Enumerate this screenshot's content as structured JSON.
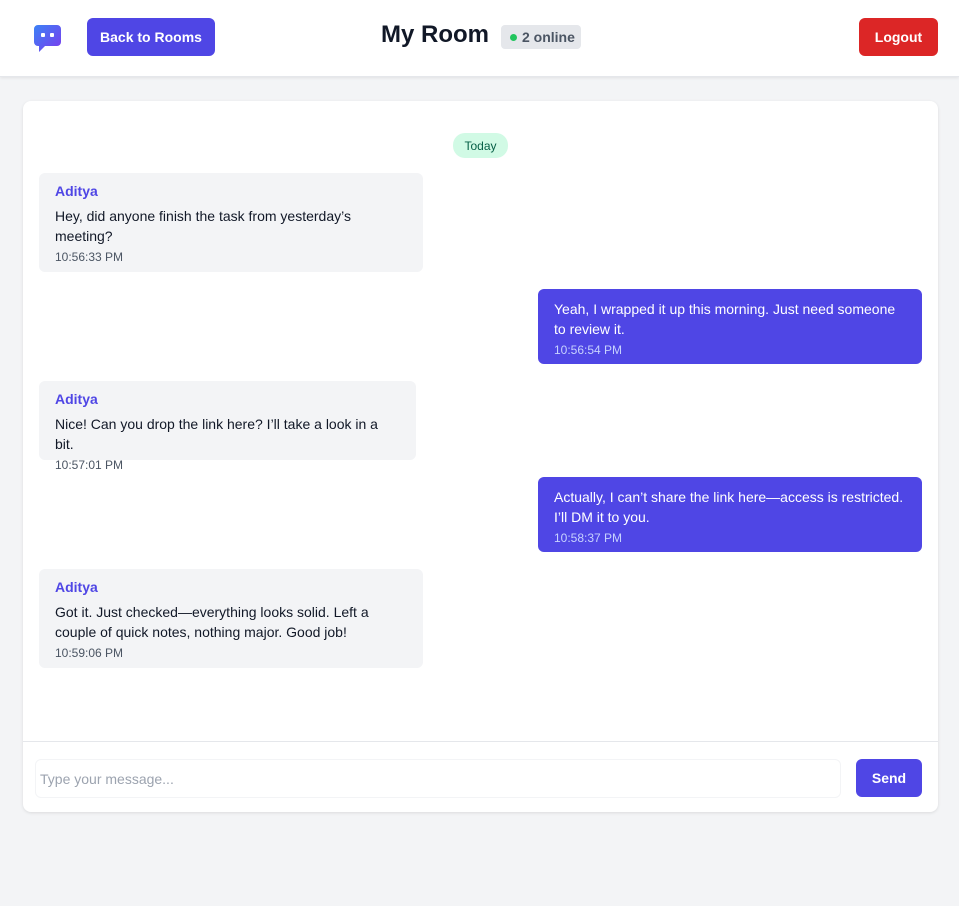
{
  "header": {
    "back_label": "Back to Rooms",
    "room_title": "My Room",
    "online_text": "2 online",
    "logout_label": "Logout"
  },
  "chat": {
    "date_label": "Today",
    "messages": [
      {
        "sender": "Aditya",
        "text": "Hey, did anyone finish the task from yesterday’s meeting?",
        "time": "10:56:33 PM",
        "mine": false
      },
      {
        "sender": "",
        "text": "Yeah, I wrapped it up this morning. Just need someone to review it.",
        "time": "10:56:54 PM",
        "mine": true
      },
      {
        "sender": "Aditya",
        "text": "Nice! Can you drop the link here? I’ll take a look in a bit.",
        "time": "10:57:01 PM",
        "mine": false
      },
      {
        "sender": "",
        "text": "Actually, I can’t share the link here—access is restricted. I’ll DM it to you.",
        "time": "10:58:37 PM",
        "mine": true
      },
      {
        "sender": "Aditya",
        "text": "Got it. Just checked—everything looks solid. Left a couple of quick notes, nothing major. Good job!",
        "time": "10:59:06 PM",
        "mine": false
      }
    ]
  },
  "composer": {
    "placeholder": "Type your message...",
    "value": "",
    "send_label": "Send"
  },
  "colors": {
    "accent": "#4f46e5",
    "danger": "#dc2626",
    "online": "#22c55e",
    "date_pill_bg": "#d1fae5"
  },
  "icons": {
    "logo": "chat-bubble-logo-icon",
    "online": "status-dot-icon"
  }
}
